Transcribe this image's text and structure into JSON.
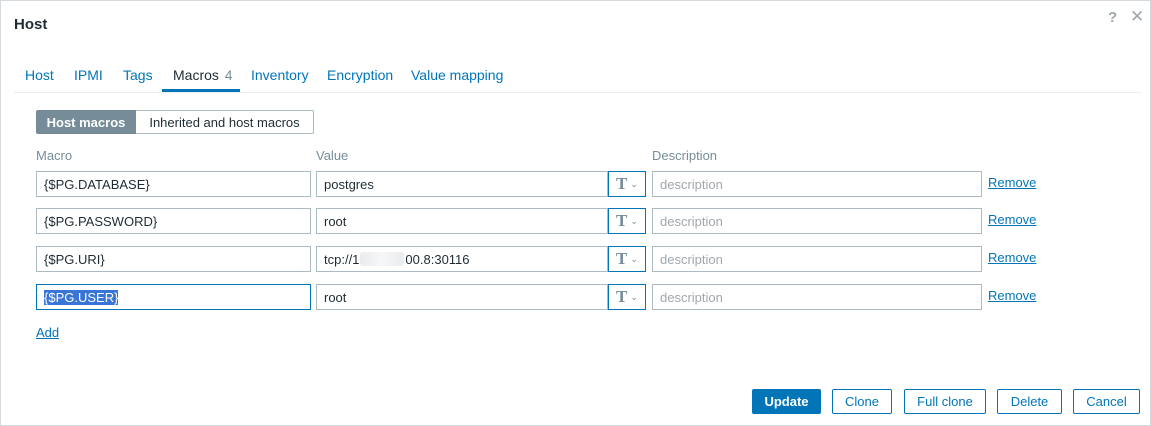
{
  "dialog": {
    "title": "Host",
    "help_icon": "?",
    "close_icon": "✕"
  },
  "tabs": [
    {
      "label": "Host"
    },
    {
      "label": "IPMI"
    },
    {
      "label": "Tags"
    },
    {
      "label": "Macros",
      "count": "4",
      "active": true
    },
    {
      "label": "Inventory"
    },
    {
      "label": "Encryption"
    },
    {
      "label": "Value mapping"
    }
  ],
  "macro_mode": {
    "host_macros": "Host macros",
    "inherited": "Inherited and host macros"
  },
  "columns": {
    "macro": "Macro",
    "value": "Value",
    "description": "Description"
  },
  "rows": [
    {
      "macro": "{$PG.DATABASE}",
      "value": "postgres",
      "desc_placeholder": "description",
      "type_icon": "T",
      "remove": "Remove"
    },
    {
      "macro": "{$PG.PASSWORD}",
      "value": "root",
      "desc_placeholder": "description",
      "type_icon": "T",
      "remove": "Remove"
    },
    {
      "macro": "{$PG.URI}",
      "value_prefix": "tcp://1",
      "value_suffix": "00.8:30116",
      "desc_placeholder": "description",
      "type_icon": "T",
      "remove": "Remove"
    },
    {
      "macro": "{$PG.USER}",
      "value": "root",
      "desc_placeholder": "description",
      "type_icon": "T",
      "remove": "Remove"
    }
  ],
  "add_label": "Add",
  "footer": {
    "update": "Update",
    "clone": "Clone",
    "full_clone": "Full clone",
    "delete": "Delete",
    "cancel": "Cancel"
  },
  "colors": {
    "accent": "#0275b8",
    "muted": "#768d99",
    "selection": "#3875d7"
  }
}
